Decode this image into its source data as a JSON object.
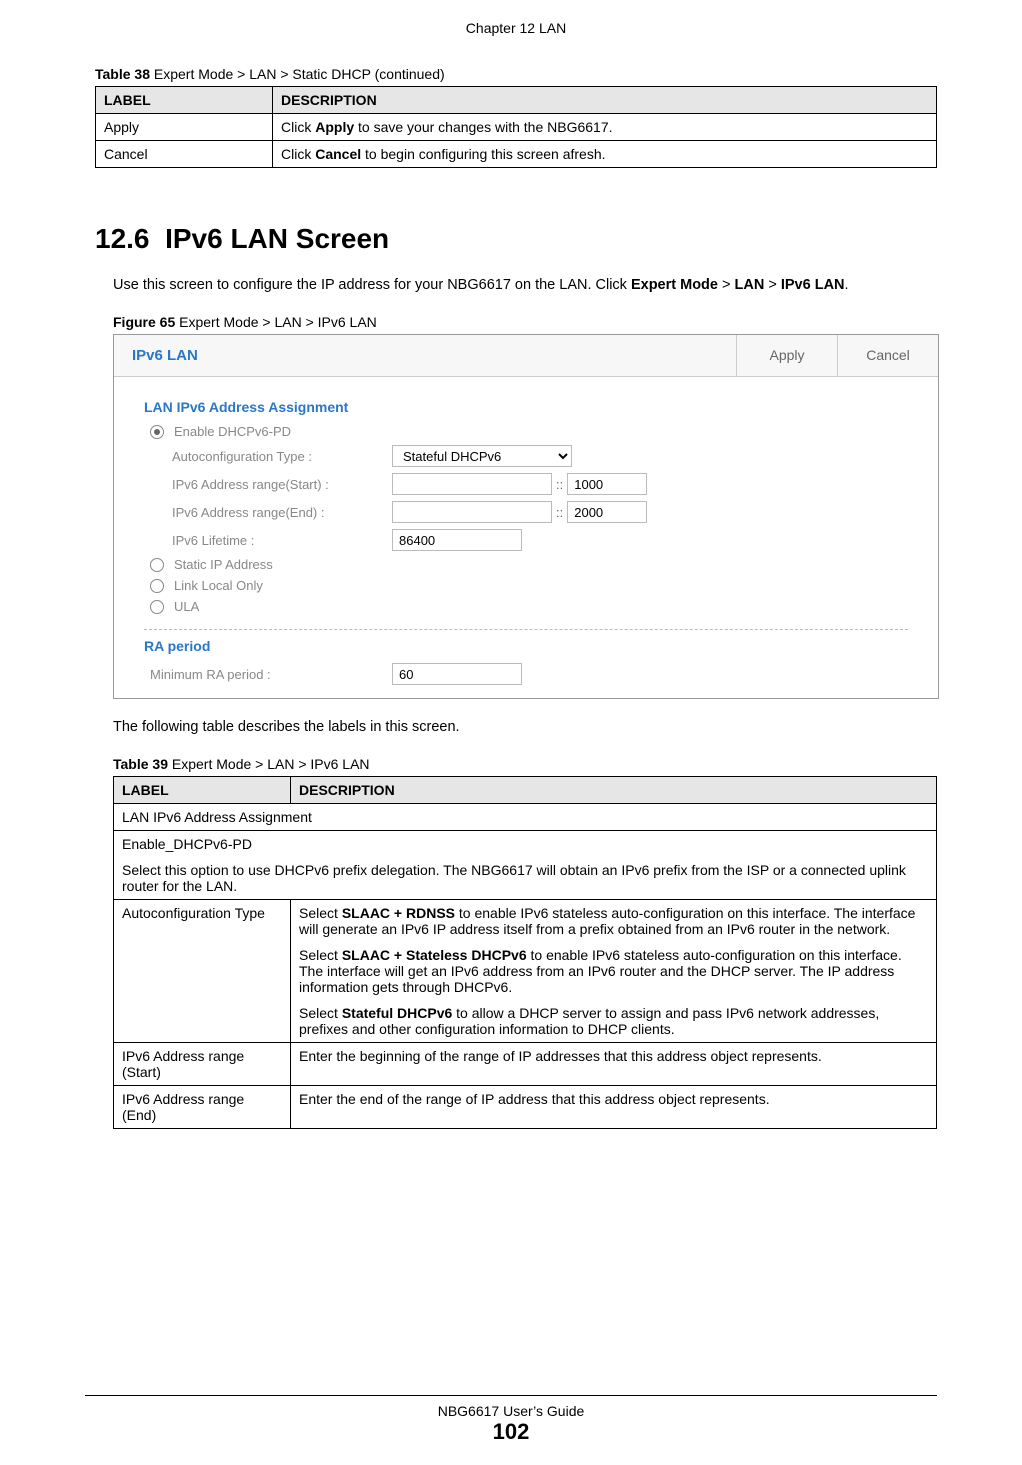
{
  "header": {
    "chapter": "Chapter 12 LAN"
  },
  "table38": {
    "caption_label": "Table 38",
    "caption_rest": "   Expert Mode > LAN > Static DHCP  (continued)",
    "head": {
      "label": "LABEL",
      "desc": "DESCRIPTION"
    },
    "rows": [
      {
        "label": "Apply",
        "desc_pre": "Click ",
        "desc_bold": "Apply",
        "desc_post": " to save your changes with the NBG6617."
      },
      {
        "label": "Cancel",
        "desc_pre": "Click ",
        "desc_bold": "Cancel",
        "desc_post": " to begin configuring this screen afresh."
      }
    ]
  },
  "section": {
    "number": "12.6",
    "title": "IPv6 LAN Screen",
    "intro_pre": "Use this screen to configure the IP address for your NBG6617 on the LAN. Click ",
    "intro_b1": "Expert Mode",
    "intro_mid1": " > ",
    "intro_b2": "LAN",
    "intro_mid2": " > ",
    "intro_b3": "IPv6 LAN",
    "intro_post": "."
  },
  "figure": {
    "label": "Figure 65",
    "rest": "   Expert Mode > LAN > IPv6 LAN"
  },
  "panel": {
    "title": "IPv6 LAN",
    "apply": "Apply",
    "cancel": "Cancel",
    "sect1": "LAN IPv6 Address Assignment",
    "radios": {
      "enable": "Enable DHCPv6-PD",
      "staticip": "Static IP Address",
      "linklocal": "Link Local Only",
      "ula": "ULA"
    },
    "fields": {
      "autoconf": "Autoconfiguration Type :",
      "autoconf_value": "Stateful DHCPv6",
      "range_start": "IPv6 Address range(Start) :",
      "range_start_suffix": "1000",
      "range_end": "IPv6 Address range(End) :",
      "range_end_suffix": "2000",
      "lifetime": "IPv6 Lifetime :",
      "lifetime_value": "86400"
    },
    "sect2": "RA period",
    "ra_label": "Minimum RA period :",
    "ra_value": "60"
  },
  "after_panel": "The following table describes the labels in this screen.",
  "table39": {
    "caption_label": "Table 39",
    "caption_rest": "   Expert Mode > LAN > IPv6 LAN",
    "head": {
      "label": "LABEL",
      "desc": "DESCRIPTION"
    },
    "row_span1": "LAN IPv6 Address Assignment",
    "row_span2a": "Enable_DHCPv6-PD",
    "row_span2b": "Select this option to use DHCPv6 prefix delegation. The NBG6617 will obtain an IPv6 prefix from the ISP or a connected uplink router for the LAN.",
    "rows": {
      "autoconf": {
        "label": "Autoconfiguration Type",
        "p1_pre": "Select ",
        "p1_b": "SLAAC + RDNSS",
        "p1_post": " to enable IPv6 stateless auto-configuration on this interface. The interface will generate an IPv6 IP address itself from a prefix obtained from an IPv6 router in the network.",
        "p2_pre": "Select ",
        "p2_b": "SLAAC + Stateless DHCPv6",
        "p2_post": " to enable IPv6 stateless auto-configuration on this interface. The interface will get an IPv6 address from an IPv6 router and the DHCP server. The IP address information gets through DHCPv6.",
        "p3_pre": "Select ",
        "p3_b": "Stateful DHCPv6",
        "p3_post": " to allow a DHCP server to assign and pass IPv6 network addresses, prefixes and other configuration information to DHCP clients."
      },
      "range_start": {
        "label": "IPv6 Address range (Start)",
        "desc": "Enter the beginning of the range of IP addresses that this address object represents."
      },
      "range_end": {
        "label": "IPv6 Address range (End)",
        "desc": "Enter the end of the range of IP address that this address object represents."
      }
    }
  },
  "footer": {
    "guide": "NBG6617 User’s Guide",
    "page": "102"
  }
}
